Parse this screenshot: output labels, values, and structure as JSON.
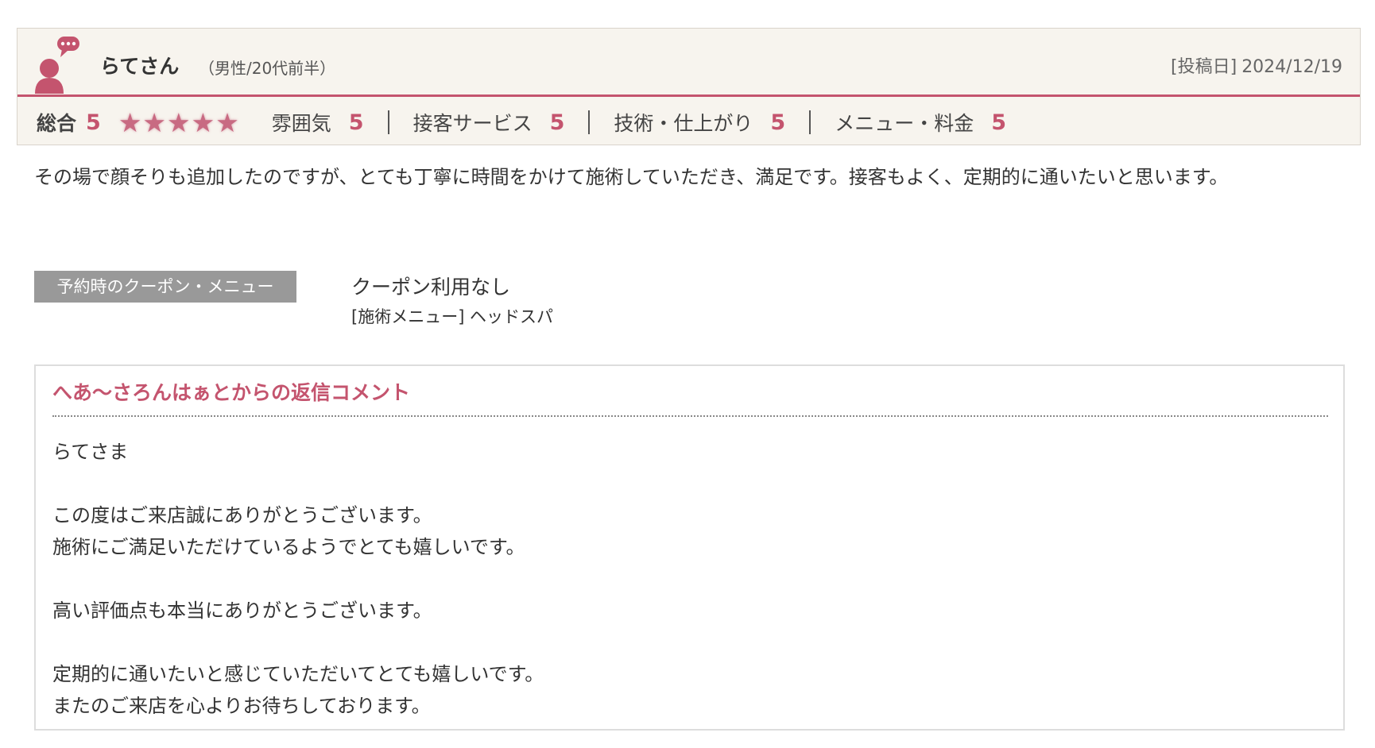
{
  "user": {
    "name": "らてさん",
    "attributes": "（男性/20代前半）",
    "icon": "user-speech-icon"
  },
  "post": {
    "date_label": "[投稿日]",
    "date": "2024/12/19"
  },
  "ratings": {
    "overall_label": "総合",
    "overall_score": "5",
    "stars": 5,
    "categories": [
      {
        "label": "雰囲気",
        "score": "5"
      },
      {
        "label": "接客サービス",
        "score": "5"
      },
      {
        "label": "技術・仕上がり",
        "score": "5"
      },
      {
        "label": "メニュー・料金",
        "score": "5"
      }
    ]
  },
  "review_text": "その場で顔そりも追加したのですが、とても丁寧に時間をかけて施術していただき、満足です。接客もよく、定期的に通いたいと思います。",
  "coupon": {
    "badge": "予約時のクーポン・メニュー",
    "name": "クーポン利用なし",
    "menu": "[施術メニュー] ヘッドスパ"
  },
  "reply": {
    "title": "へあ〜さろんはぁとからの返信コメント",
    "text": "らてさま\n\nこの度はご来店誠にありがとうございます。\n施術にご満足いただけているようでとても嬉しいです。\n\n高い評価点も本当にありがとうございます。\n\n定期的に通いたいと感じていただいてとても嬉しいです。\nまたのご来店を心よりお待ちしております。"
  },
  "colors": {
    "accent": "#c4546e",
    "header_bg": "#f7f4ee",
    "badge_bg": "#999999"
  }
}
